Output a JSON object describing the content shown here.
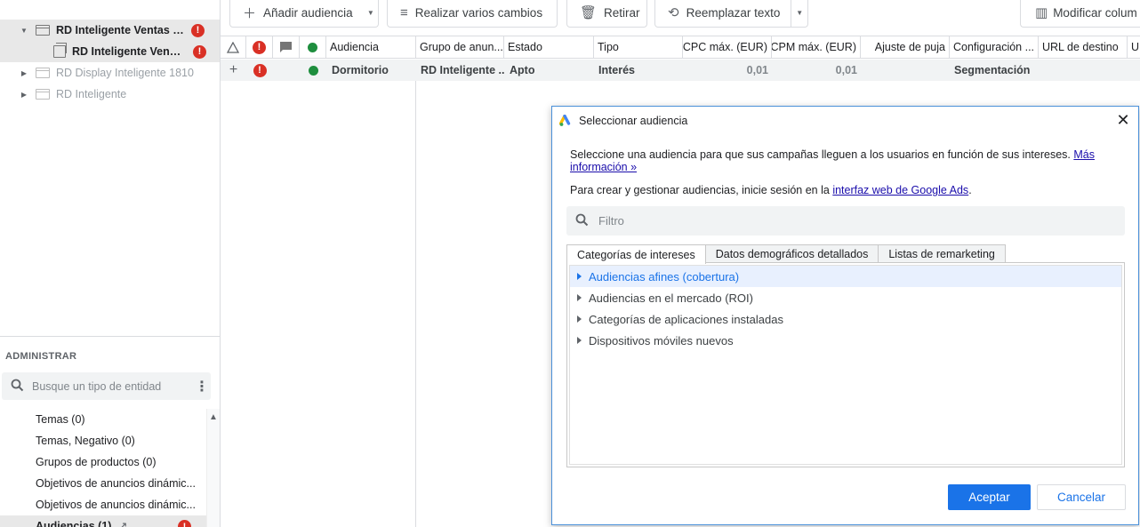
{
  "tree": [
    {
      "label": "RD Inteligente Ventas R5...",
      "error": "!"
    },
    {
      "label": "RD Inteligente Ventas ...",
      "error": "!"
    },
    {
      "label": "RD Display Inteligente 1810"
    },
    {
      "label": "RD Inteligente"
    }
  ],
  "admin": {
    "title": "ADMINISTRAR",
    "search_placeholder": "Busque un tipo de entidad",
    "items": [
      "Temas (0)",
      "Temas, Negativo (0)",
      "Grupos de productos (0)",
      "Objetivos de anuncios dinámic...",
      "Objetivos de anuncios dinámic...",
      "Audiencias (1)"
    ],
    "item_error": "!"
  },
  "toolbar": {
    "add_audience": "Añadir audiencia",
    "multiple_changes": "Realizar varios cambios",
    "remove": "Retirar",
    "replace_text": "Reemplazar texto",
    "modify_columns": "Modificar colum"
  },
  "grid": {
    "headers": [
      "Audiencia",
      "Grupo de anun...",
      "Estado",
      "Tipo",
      "CPC máx. (EUR)",
      "CPM máx. (EUR)",
      "Ajuste de puja",
      "Configuración ...",
      "URL de destino",
      "UR"
    ],
    "row": {
      "error": "!",
      "audience": "Dormitorio",
      "ad_group": "RD Inteligente ...",
      "status": "Apto",
      "type": "Interés",
      "cpc": "0,01",
      "cpm": "0,01",
      "config": "Segmentación"
    }
  },
  "dialog": {
    "title": "Seleccionar audiencia",
    "close": "✕",
    "intro": "Seleccione una audiencia para que sus campañas lleguen a los usuarios en función de sus intereses.",
    "more_info": "Más información »",
    "login_text": "Para crear y gestionar audiencias, inicie sesión en la",
    "ads_link": "interfaz web de Google Ads",
    "filter_placeholder": "Filtro",
    "tabs": [
      "Categorías de intereses",
      "Datos demográficos detallados",
      "Listas de remarketing"
    ],
    "categories": [
      "Audiencias afines (cobertura)",
      "Audiencias en el mercado (ROI)",
      "Categorías de aplicaciones instaladas",
      "Dispositivos móviles nuevos"
    ],
    "accept": "Aceptar",
    "cancel": "Cancelar"
  },
  "colors": {
    "accent": "#1a73e8",
    "error": "#d93025",
    "enabled": "#1e8e3e"
  }
}
